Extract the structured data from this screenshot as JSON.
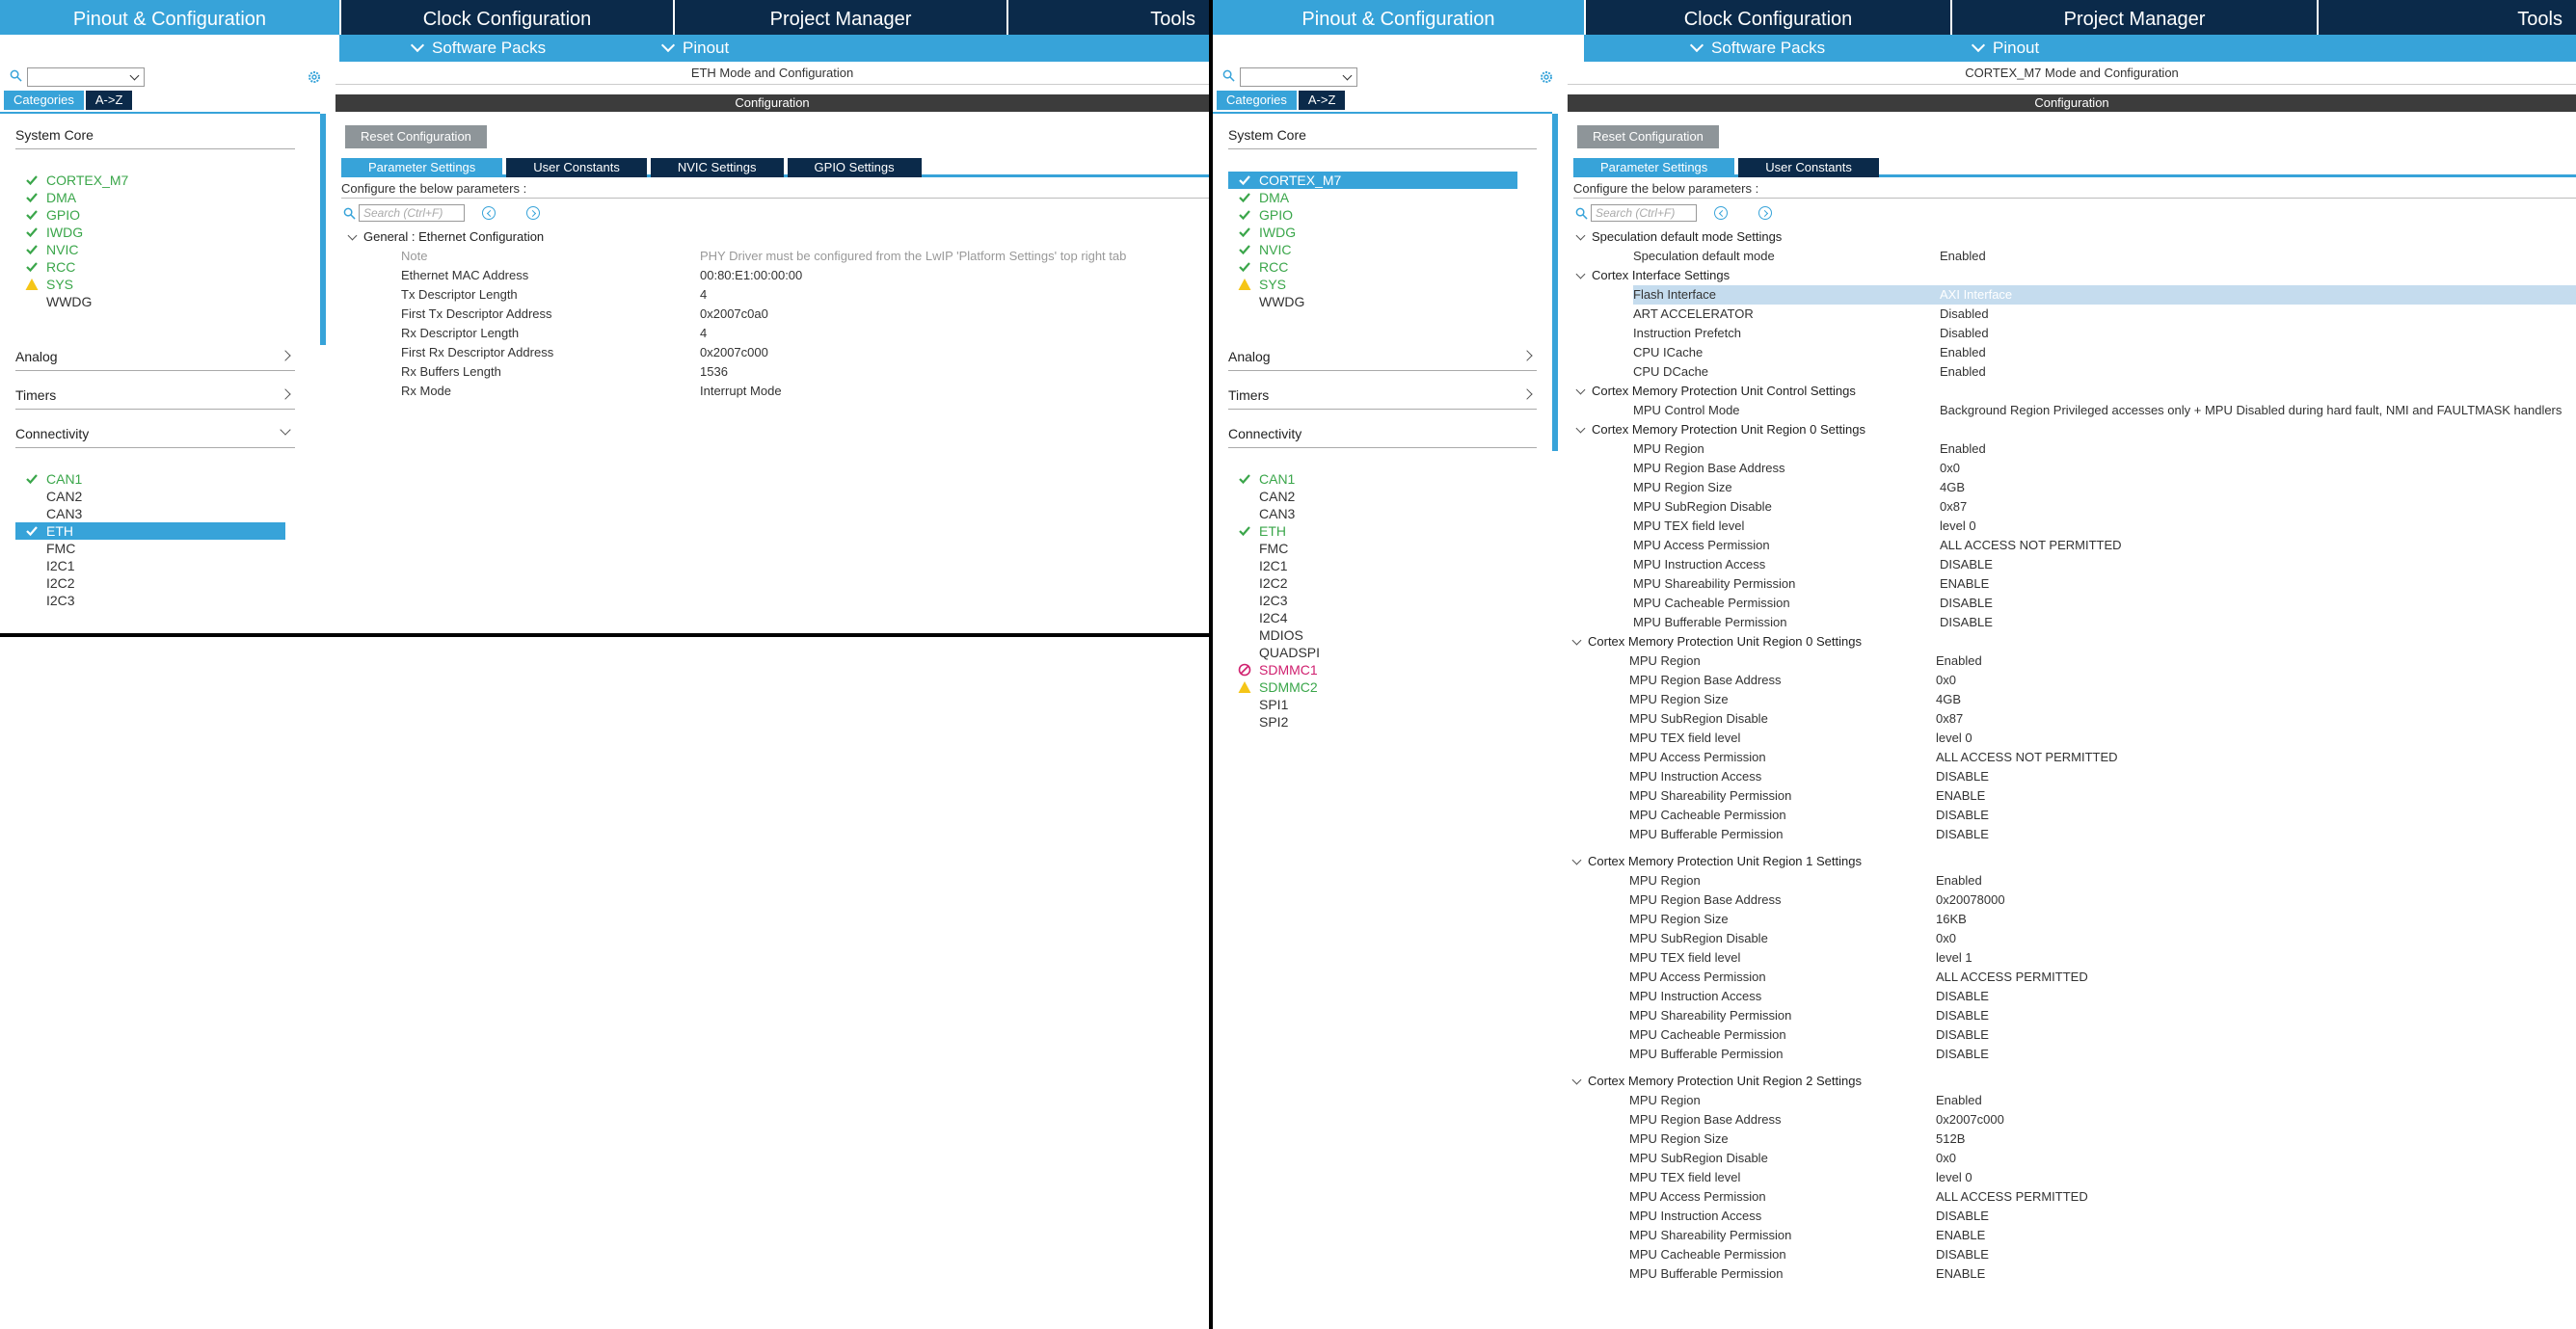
{
  "top_tabs": [
    "Pinout & Configuration",
    "Clock Configuration",
    "Project Manager",
    "Tools"
  ],
  "sub_tabs": [
    "Software Packs",
    "Pinout"
  ],
  "category_tabs": [
    "Categories",
    "A->Z"
  ],
  "groups": {
    "system_core": "System Core",
    "analog": "Analog",
    "timers": "Timers",
    "connectivity": "Connectivity"
  },
  "colors": {
    "accent": "#37a3d9",
    "navy": "#0b2a4a",
    "green": "#3aa64a",
    "warning": "#f5c518",
    "error": "#d0206f",
    "conf_bar": "#3c3c3c"
  },
  "left": {
    "system_core_items": [
      {
        "label": "CORTEX_M7",
        "status": "check"
      },
      {
        "label": "DMA",
        "status": "check"
      },
      {
        "label": "GPIO",
        "status": "check"
      },
      {
        "label": "IWDG",
        "status": "check"
      },
      {
        "label": "NVIC",
        "status": "check"
      },
      {
        "label": "RCC",
        "status": "check"
      },
      {
        "label": "SYS",
        "status": "warning"
      },
      {
        "label": "WWDG",
        "status": "none"
      }
    ],
    "connectivity_items": [
      {
        "label": "CAN1",
        "status": "check"
      },
      {
        "label": "CAN2",
        "status": "none"
      },
      {
        "label": "CAN3",
        "status": "none"
      },
      {
        "label": "ETH",
        "status": "check",
        "selected": true
      },
      {
        "label": "FMC",
        "status": "none"
      },
      {
        "label": "I2C1",
        "status": "none"
      },
      {
        "label": "I2C2",
        "status": "none"
      },
      {
        "label": "I2C3",
        "status": "none"
      }
    ],
    "mode_title": "ETH Mode and Configuration",
    "configuration_label": "Configuration",
    "reset_button": "Reset Configuration",
    "config_tabs": [
      "Parameter Settings",
      "User Constants",
      "NVIC Settings",
      "GPIO Settings"
    ],
    "configure_note": "Configure the below parameters :",
    "search_placeholder": "Search (Ctrl+F)",
    "section": "General : Ethernet Configuration",
    "params": [
      {
        "name": "Note",
        "value": "PHY Driver must be configured from the LwIP 'Platform Settings' top right tab",
        "grey": true
      },
      {
        "name": "Ethernet MAC Address",
        "value": "00:80:E1:00:00:00"
      },
      {
        "name": "Tx Descriptor Length",
        "value": "4"
      },
      {
        "name": "First Tx Descriptor Address",
        "value": "0x2007c0a0"
      },
      {
        "name": "Rx Descriptor Length",
        "value": "4"
      },
      {
        "name": "First Rx Descriptor Address",
        "value": "0x2007c000"
      },
      {
        "name": "Rx Buffers Length",
        "value": "1536"
      },
      {
        "name": "Rx Mode",
        "value": "Interrupt Mode"
      }
    ]
  },
  "right": {
    "system_core_items": [
      {
        "label": "CORTEX_M7",
        "status": "check",
        "selected": true
      },
      {
        "label": "DMA",
        "status": "check"
      },
      {
        "label": "GPIO",
        "status": "check"
      },
      {
        "label": "IWDG",
        "status": "check"
      },
      {
        "label": "NVIC",
        "status": "check"
      },
      {
        "label": "RCC",
        "status": "check"
      },
      {
        "label": "SYS",
        "status": "warning"
      },
      {
        "label": "WWDG",
        "status": "none"
      }
    ],
    "connectivity_items": [
      {
        "label": "CAN1",
        "status": "check"
      },
      {
        "label": "CAN2",
        "status": "none"
      },
      {
        "label": "CAN3",
        "status": "none"
      },
      {
        "label": "ETH",
        "status": "check"
      },
      {
        "label": "FMC",
        "status": "none"
      },
      {
        "label": "I2C1",
        "status": "none"
      },
      {
        "label": "I2C2",
        "status": "none"
      },
      {
        "label": "I2C3",
        "status": "none"
      },
      {
        "label": "I2C4",
        "status": "none"
      },
      {
        "label": "MDIOS",
        "status": "none"
      },
      {
        "label": "QUADSPI",
        "status": "none"
      },
      {
        "label": "SDMMC1",
        "status": "error"
      },
      {
        "label": "SDMMC2",
        "status": "warning"
      },
      {
        "label": "SPI1",
        "status": "none"
      },
      {
        "label": "SPI2",
        "status": "none"
      }
    ],
    "mode_title": "CORTEX_M7 Mode and Configuration",
    "configuration_label": "Configuration",
    "reset_button": "Reset Configuration",
    "config_tabs": [
      "Parameter Settings",
      "User Constants"
    ],
    "configure_note": "Configure the below parameters :",
    "search_placeholder": "Search (Ctrl+F)",
    "rows": [
      {
        "t": "sec",
        "name": "Speculation default mode Settings"
      },
      {
        "t": "p",
        "name": "Speculation default mode",
        "value": "Enabled"
      },
      {
        "t": "sec",
        "name": "Cortex Interface Settings"
      },
      {
        "t": "p",
        "name": "Flash Interface",
        "value": "AXI Interface",
        "hl": true
      },
      {
        "t": "p",
        "name": "ART ACCELERATOR",
        "value": "Disabled"
      },
      {
        "t": "p",
        "name": "Instruction Prefetch",
        "value": "Disabled"
      },
      {
        "t": "p",
        "name": "CPU ICache",
        "value": "Enabled"
      },
      {
        "t": "p",
        "name": "CPU DCache",
        "value": "Enabled"
      },
      {
        "t": "sec",
        "name": "Cortex Memory Protection Unit Control Settings"
      },
      {
        "t": "p",
        "name": "MPU Control Mode",
        "value": "Background Region Privileged accesses only + MPU Disabled during hard fault, NMI and FAULTMASK handlers"
      },
      {
        "t": "sec",
        "name": "Cortex Memory Protection Unit Region 0 Settings"
      },
      {
        "t": "p",
        "name": "MPU Region",
        "value": "Enabled"
      },
      {
        "t": "p",
        "name": "MPU Region Base Address",
        "value": "0x0"
      },
      {
        "t": "p",
        "name": "MPU Region Size",
        "value": "4GB"
      },
      {
        "t": "p",
        "name": "MPU SubRegion Disable",
        "value": "0x87"
      },
      {
        "t": "p",
        "name": "MPU TEX field level",
        "value": "level 0"
      },
      {
        "t": "p",
        "name": "MPU Access Permission",
        "value": "ALL ACCESS NOT PERMITTED"
      },
      {
        "t": "p",
        "name": "MPU Instruction Access",
        "value": "DISABLE"
      },
      {
        "t": "p",
        "name": "MPU Shareability Permission",
        "value": "ENABLE"
      },
      {
        "t": "p",
        "name": "MPU Cacheable Permission",
        "value": "DISABLE"
      },
      {
        "t": "p",
        "name": "MPU Bufferable  Permission",
        "value": "DISABLE"
      }
    ],
    "region_blocks": [
      {
        "title": "Cortex Memory Protection Unit Region 0 Settings",
        "rows": [
          {
            "name": "MPU Region",
            "value": "Enabled"
          },
          {
            "name": "MPU Region Base Address",
            "value": "0x0"
          },
          {
            "name": "MPU Region Size",
            "value": "4GB"
          },
          {
            "name": "MPU SubRegion Disable",
            "value": "0x87"
          },
          {
            "name": "MPU TEX field level",
            "value": "level 0"
          },
          {
            "name": "MPU Access Permission",
            "value": "ALL ACCESS NOT PERMITTED"
          },
          {
            "name": "MPU Instruction Access",
            "value": "DISABLE"
          },
          {
            "name": "MPU Shareability Permission",
            "value": "ENABLE"
          },
          {
            "name": "MPU Cacheable Permission",
            "value": "DISABLE"
          },
          {
            "name": "MPU Bufferable  Permission",
            "value": "DISABLE"
          }
        ]
      },
      {
        "title": "Cortex Memory Protection Unit Region 1 Settings",
        "rows": [
          {
            "name": "MPU Region",
            "value": "Enabled"
          },
          {
            "name": "MPU Region Base Address",
            "value": "0x20078000"
          },
          {
            "name": "MPU Region Size",
            "value": "16KB"
          },
          {
            "name": "MPU SubRegion Disable",
            "value": "0x0"
          },
          {
            "name": "MPU TEX field level",
            "value": "level 1"
          },
          {
            "name": "MPU Access Permission",
            "value": "ALL ACCESS PERMITTED"
          },
          {
            "name": "MPU Instruction Access",
            "value": "DISABLE"
          },
          {
            "name": "MPU Shareability Permission",
            "value": "DISABLE"
          },
          {
            "name": "MPU Cacheable Permission",
            "value": "DISABLE"
          },
          {
            "name": "MPU Bufferable  Permission",
            "value": "DISABLE"
          }
        ]
      },
      {
        "title": "Cortex Memory Protection Unit Region 2 Settings",
        "rows": [
          {
            "name": "MPU Region",
            "value": "Enabled"
          },
          {
            "name": "MPU Region Base Address",
            "value": "0x2007c000"
          },
          {
            "name": "MPU Region Size",
            "value": "512B"
          },
          {
            "name": "MPU SubRegion Disable",
            "value": "0x0"
          },
          {
            "name": "MPU TEX field level",
            "value": "level 0"
          },
          {
            "name": "MPU Access Permission",
            "value": "ALL ACCESS PERMITTED"
          },
          {
            "name": "MPU Instruction Access",
            "value": "DISABLE"
          },
          {
            "name": "MPU Shareability Permission",
            "value": "ENABLE"
          },
          {
            "name": "MPU Cacheable Permission",
            "value": "DISABLE"
          },
          {
            "name": "MPU Bufferable  Permission",
            "value": "ENABLE"
          }
        ]
      }
    ]
  }
}
